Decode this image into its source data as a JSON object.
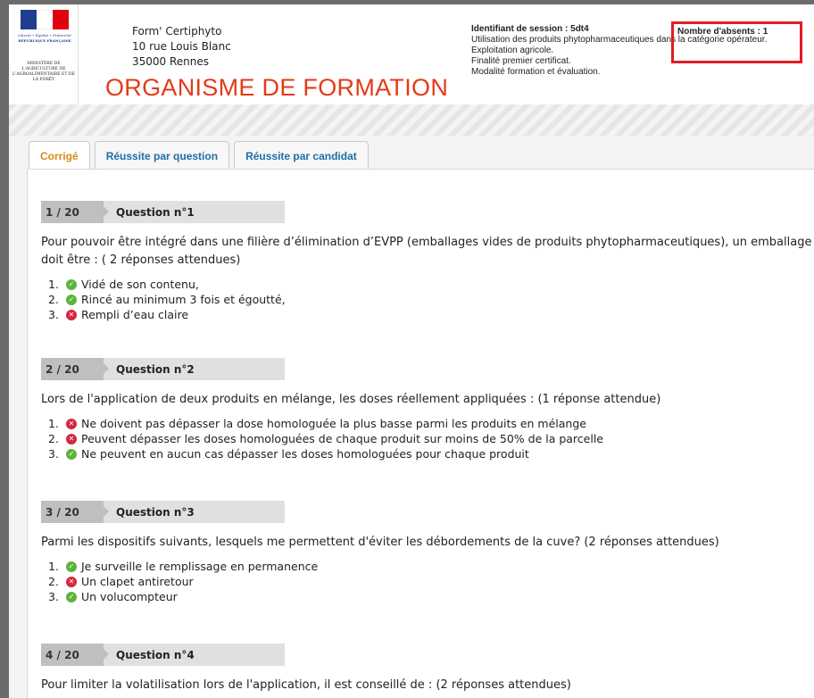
{
  "header": {
    "logo": {
      "motto": "Liberté • Égalité • Fraternité",
      "republic": "RÉPUBLIQUE FRANÇAISE",
      "ministry": "MINISTÈRE DE L'AGRICULTURE DE L'AGROALIMENTAIRE ET DE LA FORÊT"
    },
    "org_name": "Form' Certiphyto",
    "org_street": "10 rue Louis Blanc",
    "org_city": "35000 Rennes",
    "org_title": "ORGANISME DE FORMATION",
    "session_id": "Identifiant de session : 5dt4",
    "session_line1": "Utilisation des produits phytopharmaceutiques dans la catégorie opérateur.",
    "session_line2": "Exploitation agricole.",
    "session_line3": "Finalité premier certificat.",
    "session_line4": "Modalité formation et évaluation.",
    "absents": "Nombre d'absents : 1"
  },
  "colors": {
    "ok": "#5cb43c",
    "ko": "#d7263b",
    "active_tab": "#d98a18",
    "tab": "#1d6fa5",
    "title": "#e33b17"
  },
  "tabs": [
    {
      "label": "Corrigé",
      "active": true
    },
    {
      "label": "Réussite par question",
      "active": false
    },
    {
      "label": "Réussite par candidat",
      "active": false
    }
  ],
  "questions": [
    {
      "num": "1 / 20",
      "title": "Question n°1",
      "text": "Pour pouvoir être intégré dans une filière d’élimination d’EVPP (emballages vides de produits phytopharmaceutiques), un emballage doit être : ( 2 réponses attendues)",
      "answers": [
        {
          "n": "1.",
          "label": "Vidé de son contenu,",
          "status": "ok"
        },
        {
          "n": "2.",
          "label": "Rincé au minimum 3 fois et égoutté,",
          "status": "ok"
        },
        {
          "n": "3.",
          "label": "Rempli d’eau claire",
          "status": "ko"
        }
      ]
    },
    {
      "num": "2 / 20",
      "title": "Question n°2",
      "text": "Lors de l'application de deux produits en mélange, les doses réellement appliquées : (1 réponse attendue)",
      "answers": [
        {
          "n": "1.",
          "label": "Ne doivent pas dépasser la dose homologuée la plus basse parmi les produits en mélange",
          "status": "ko"
        },
        {
          "n": "2.",
          "label": "Peuvent dépasser les doses homologuées de chaque produit sur moins de 50% de la parcelle",
          "status": "ko"
        },
        {
          "n": "3.",
          "label": "Ne peuvent en aucun cas dépasser les doses homologuées pour chaque produit",
          "status": "ok"
        }
      ]
    },
    {
      "num": "3 / 20",
      "title": "Question n°3",
      "text": "Parmi les dispositifs suivants, lesquels me permettent d'éviter les débordements de la cuve? (2 réponses attendues)",
      "answers": [
        {
          "n": "1.",
          "label": "Je surveille le remplissage en permanence",
          "status": "ok"
        },
        {
          "n": "2.",
          "label": "Un clapet antiretour",
          "status": "ko"
        },
        {
          "n": "3.",
          "label": "Un volucompteur",
          "status": "ok"
        }
      ]
    },
    {
      "num": "4 / 20",
      "title": "Question n°4",
      "text": "Pour limiter la volatilisation lors de l'application, il est conseillé de : (2 réponses attendues)",
      "answers": []
    }
  ]
}
